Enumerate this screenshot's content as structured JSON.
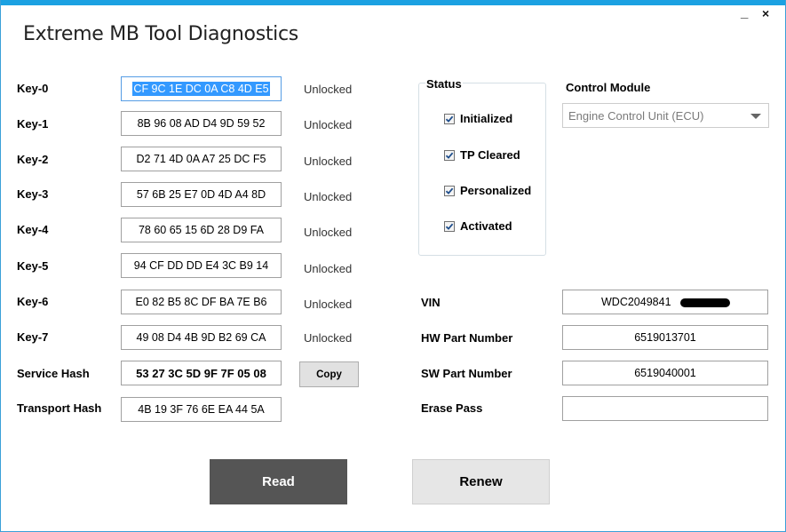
{
  "window": {
    "title": "Extreme MB Tool Diagnostics",
    "minimize_label": "_",
    "close_label": "×"
  },
  "keys": [
    {
      "label": "Key-0",
      "value": "CF 9C 1E DC 0A C8 4D E5",
      "state": "Unlocked"
    },
    {
      "label": "Key-1",
      "value": "8B 96 08 AD D4 9D 59 52",
      "state": "Unlocked"
    },
    {
      "label": "Key-2",
      "value": "D2 71 4D 0A A7 25 DC F5",
      "state": "Unlocked"
    },
    {
      "label": "Key-3",
      "value": "57 6B 25 E7 0D 4D A4 8D",
      "state": "Unlocked"
    },
    {
      "label": "Key-4",
      "value": "78 60 65 15 6D 28 D9 FA",
      "state": "Unlocked"
    },
    {
      "label": "Key-5",
      "value": "94 CF DD DD E4 3C B9 14",
      "state": "Unlocked"
    },
    {
      "label": "Key-6",
      "value": "E0 82 B5 8C DF BA 7E B6",
      "state": "Unlocked"
    },
    {
      "label": "Key-7",
      "value": "49 08 D4 4B 9D B2 69 CA",
      "state": "Unlocked"
    }
  ],
  "service_hash": {
    "label": "Service Hash",
    "value": "53 27 3C 5D 9F 7F 05 08",
    "copy_label": "Copy"
  },
  "transport_hash": {
    "label": "Transport Hash",
    "value": "4B 19 3F 76 6E EA 44 5A"
  },
  "status": {
    "legend": "Status",
    "items": [
      {
        "label": "Initialized",
        "checked": true
      },
      {
        "label": "TP Cleared",
        "checked": true
      },
      {
        "label": "Personalized",
        "checked": true
      },
      {
        "label": "Activated",
        "checked": true
      }
    ]
  },
  "control_module": {
    "label": "Control Module",
    "selected": "Engine Control Unit (ECU)"
  },
  "vehicle": {
    "vin_label": "VIN",
    "vin_value": "WDC2049841",
    "hw_label": "HW Part Number",
    "hw_value": "6519013701",
    "sw_label": "SW Part Number",
    "sw_value": "6519040001",
    "erase_label": "Erase Pass",
    "erase_value": ""
  },
  "actions": {
    "read_label": "Read",
    "renew_label": "Renew"
  },
  "colors": {
    "accent": "#1ba1e2",
    "read_button": "#555555",
    "renew_button": "#e6e6e6",
    "selection": "#3399ff"
  }
}
